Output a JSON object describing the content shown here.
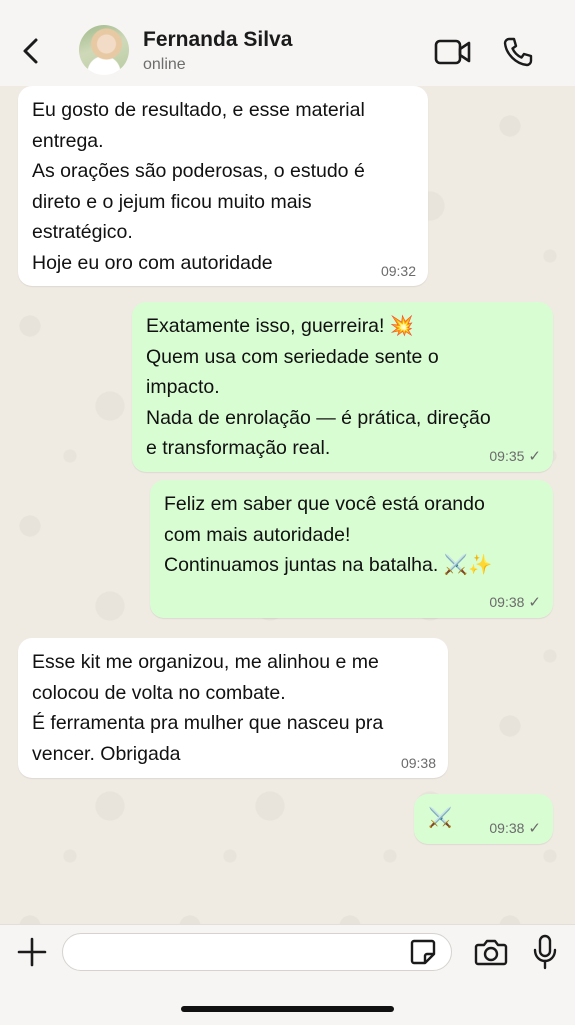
{
  "contact": {
    "name": "Fernanda Silva",
    "status": "online"
  },
  "messages": [
    {
      "direction": "incoming",
      "text": "Eu gosto de resultado, e esse material\nentrega.\nAs orações são poderosas, o estudo é\ndireto e o jejum ficou muito mais\nestratégico.\nHoje eu oro com autoridade",
      "time": "09:32"
    },
    {
      "direction": "outgoing",
      "text": "Exatamente isso, guerreira! 💥\nQuem usa com seriedade sente o\nimpacto.\nNada de enrolação — é prática, direção\ne transformação real.",
      "time": "09:35",
      "status": "✓"
    },
    {
      "direction": "outgoing",
      "text": "Feliz em saber que você está orando\ncom mais autoridade!\nContinuamos juntas na batalha. ⚔️✨",
      "time": "09:38",
      "status": "✓"
    },
    {
      "direction": "incoming",
      "text": "Esse kit me organizou, me alinhou e me\ncolocou de volta no combate.\nÉ ferramenta pra mulher que nasceu pra\nvencer. Obrigada",
      "time": "09:38"
    },
    {
      "direction": "outgoing",
      "text": "⚔️",
      "time": "09:38",
      "status": "✓"
    }
  ],
  "icons": {
    "back": "chevron-left-icon",
    "video": "video-camera-icon",
    "call": "phone-icon",
    "add": "plus-icon",
    "sticker": "sticker-icon",
    "camera": "camera-icon",
    "mic": "microphone-icon"
  },
  "colors": {
    "outgoing_bubble": "#d9fdd3",
    "incoming_bubble": "#ffffff",
    "chat_background": "#efeae2"
  },
  "composer": {
    "value": "",
    "placeholder": ""
  }
}
